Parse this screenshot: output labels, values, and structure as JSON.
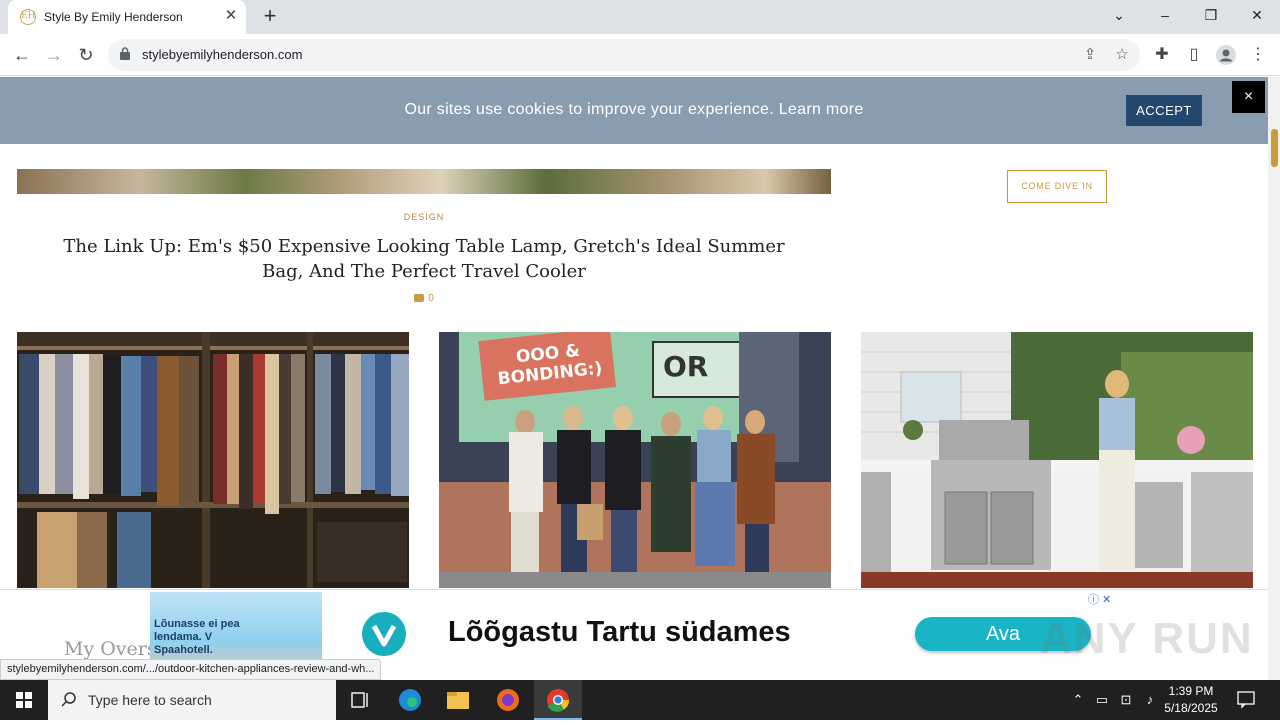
{
  "browser": {
    "tab_title": "Style By Emily Henderson",
    "tab_close": "✕",
    "new_tab": "+",
    "url": "stylebyemilyhenderson.com",
    "status_url": "stylebyemilyhenderson.com/.../outdoor-kitchen-appliances-review-and-wh..."
  },
  "cookie": {
    "text": "Our sites use cookies to improve your experience. Learn more",
    "accept": "ACCEPT",
    "close": "×"
  },
  "post": {
    "category": "DESIGN",
    "title": "The Link Up: Em's $50 Expensive Looking Table Lamp, Gretch's Ideal Summer Bag, And The Perfect Travel Cooler",
    "comments": "0"
  },
  "sidebar": {
    "cta": "COME DIVE IN"
  },
  "thumbs": {
    "sign_left": "OOO & BONDING:)",
    "sign_right": "OR"
  },
  "below": {
    "title_partial": "My Overs"
  },
  "ad": {
    "image_text": "Lõunasse ei pea lendama. V Spaahotell.",
    "headline": "Lõõgastu Tartu südames",
    "button": "Ava",
    "watermark": "ANY RUN"
  },
  "taskbar": {
    "search_placeholder": "Type here to search",
    "time": "1:39 PM",
    "date": "5/18/2025"
  }
}
